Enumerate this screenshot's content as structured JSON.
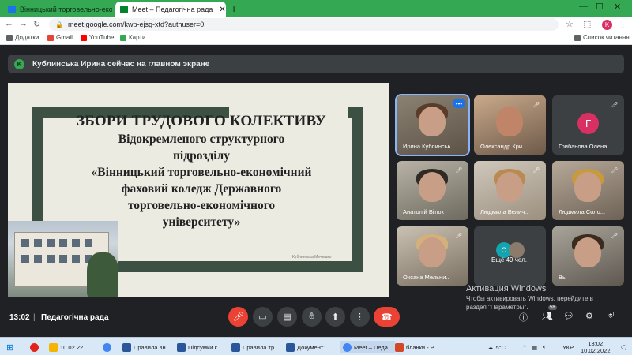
{
  "browser": {
    "tabs": [
      {
        "title": "Вінницький торговельно-еконо",
        "favicon_color": "#1a73e8",
        "active": false
      },
      {
        "title": "Meet – Педагогічна рада",
        "favicon_color": "#00832d",
        "active": true
      }
    ],
    "new_tab": "+",
    "window_controls": [
      "—",
      "☐",
      "✕"
    ],
    "url": "meet.google.com/kwp-ejsg-xtd?authuser=0",
    "profile_initial": "K",
    "reading_list_label": "Список читання",
    "bookmarks": [
      {
        "label": "Додатки",
        "icon_color": "#5f6368"
      },
      {
        "label": "Gmail",
        "icon_color": "#ea4335"
      },
      {
        "label": "YouTube",
        "icon_color": "#ff0000"
      },
      {
        "label": "Карти",
        "icon_color": "#34a853"
      }
    ]
  },
  "meet": {
    "presenting_banner": "Кублинська Ирина сейчас на главном экране",
    "presenter_initial": "K",
    "slide": {
      "title": "ЗБОРИ ТРУДОВОГО КОЛЕКТИВУ",
      "line2": "Відокремленого структурного",
      "line3": "підрозділу",
      "line4": "«Вінницький торговельно-економічний",
      "line5": "фаховий коледж Державного",
      "line6": "торговельно-економічного",
      "line7": "університету»",
      "footnote": "Кублинська Мечешко"
    },
    "tiles": [
      {
        "name": "Ирина Кублинськ...",
        "type": "video",
        "active": true
      },
      {
        "name": "Олександр Кри...",
        "type": "video",
        "active": false
      },
      {
        "name": "Грибанова Олена",
        "type": "avatar",
        "initial": "Г",
        "active": false
      },
      {
        "name": "Анатолій Вітюк",
        "type": "video",
        "active": false
      },
      {
        "name": "Людмила Велич...",
        "type": "video",
        "active": false
      },
      {
        "name": "Людмила Соло...",
        "type": "video",
        "active": false
      },
      {
        "name": "Оксана Мельни...",
        "type": "video",
        "active": false
      },
      {
        "name": "Ещё 49 чел.",
        "type": "more",
        "initial": "О",
        "active": false
      },
      {
        "name": "Вы",
        "type": "video",
        "active": false
      }
    ],
    "clock": "13:02",
    "separator": "|",
    "meeting_name": "Педагогічна рада",
    "people_count": "58",
    "activation": {
      "title": "Активация Windows",
      "line1": "Чтобы активировать Windows, перейдите в",
      "line2": "раздел \"Параметры\"."
    }
  },
  "taskbar": {
    "items": [
      {
        "label": "10.02.22",
        "icon_color": "#f4b400"
      },
      {
        "label": "",
        "icon_color": "#4285f4"
      },
      {
        "label": "Правила вн...",
        "icon_color": "#2b579a"
      },
      {
        "label": "Підсумки к...",
        "icon_color": "#2b579a"
      },
      {
        "label": "Правила тр...",
        "icon_color": "#2b579a"
      },
      {
        "label": "Документ1 ...",
        "icon_color": "#2b579a"
      },
      {
        "label": "Meet – Педа...",
        "icon_color": "#4285f4"
      },
      {
        "label": "бланки - Р...",
        "icon_color": "#d24726"
      }
    ],
    "weather": "5°C",
    "language": "УКР",
    "time": "13:02",
    "date": "10.02.2022"
  }
}
